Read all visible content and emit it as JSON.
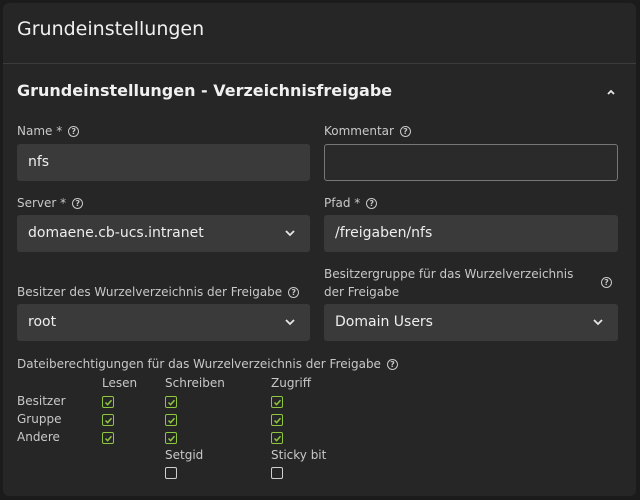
{
  "page": {
    "title": "Grundeinstellungen"
  },
  "section": {
    "title": "Grundeinstellungen - Verzeichnisfreigabe"
  },
  "fields": {
    "name": {
      "label": "Name *",
      "value": "nfs"
    },
    "comment": {
      "label": "Kommentar",
      "value": ""
    },
    "server": {
      "label": "Server *",
      "value": "domaene.cb-ucs.intranet"
    },
    "path": {
      "label": "Pfad *",
      "value": "/freigaben/nfs"
    },
    "owner": {
      "label": "Besitzer des Wurzelverzeichnis der Freigabe",
      "value": "root"
    },
    "group": {
      "label": "Besitzergruppe für das Wurzelverzeichnis der Freigabe",
      "value": "Domain Users"
    }
  },
  "permissions": {
    "label": "Dateiberechtigungen für das Wurzelverzeichnis der Freigabe",
    "columns": [
      "Lesen",
      "Schreiben",
      "Zugriff"
    ],
    "rows": [
      {
        "name": "Besitzer",
        "values": [
          true,
          true,
          true
        ]
      },
      {
        "name": "Gruppe",
        "values": [
          true,
          true,
          true
        ]
      },
      {
        "name": "Andere",
        "values": [
          true,
          true,
          true
        ]
      }
    ],
    "special": [
      {
        "name": "Setgid",
        "checked": false
      },
      {
        "name": "Sticky bit",
        "checked": false
      }
    ]
  },
  "colors": {
    "check": "#8ec63f",
    "field_bg": "#3a3a3a",
    "panel_bg": "#262626"
  },
  "icons": {
    "help": "help-circle-icon",
    "dropdown": "chevron-down-icon",
    "collapse": "chevron-up-icon"
  }
}
